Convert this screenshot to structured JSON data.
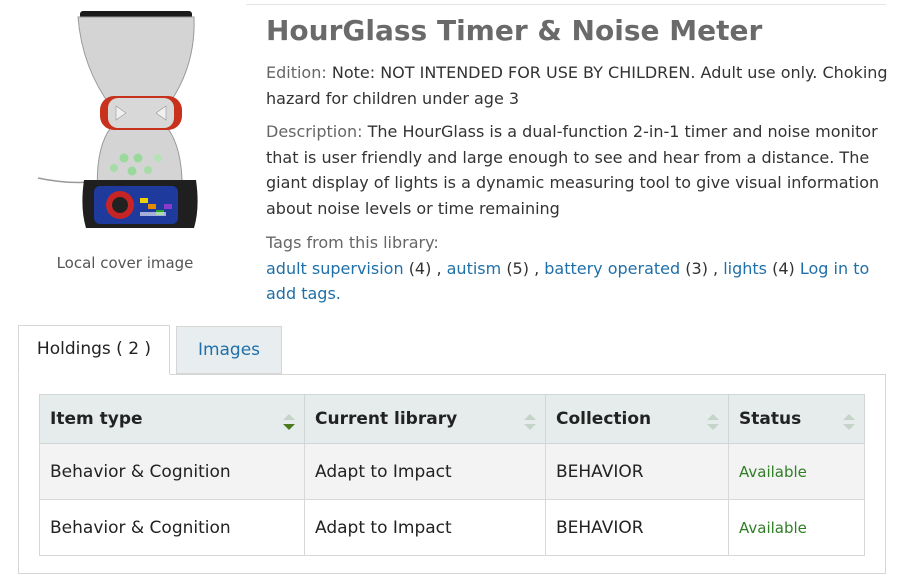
{
  "cover": {
    "caption": "Local cover image"
  },
  "title": "HourGlass Timer & Noise Meter",
  "edition": {
    "label": "Edition:",
    "value": "Note: NOT INTENDED FOR USE BY CHILDREN. Adult use only. Choking hazard for children under age 3"
  },
  "description": {
    "label": "Description:",
    "value": "The HourGlass is a dual-function 2-in-1 timer and noise monitor that is user friendly and large enough to see and hear from a distance. The giant display of lights is a dynamic measuring tool to give visual information about noise levels or time remaining"
  },
  "tags": {
    "label": "Tags from this library:",
    "items": [
      {
        "name": "adult supervision",
        "count": "(4)"
      },
      {
        "name": "autism",
        "count": "(5)"
      },
      {
        "name": "battery operated",
        "count": "(3)"
      },
      {
        "name": "lights",
        "count": "(4)"
      }
    ],
    "separator": " , ",
    "login_link": "Log in to add tags."
  },
  "tabs": {
    "holdings": "Holdings ( 2 )",
    "images": "Images"
  },
  "table": {
    "headers": [
      "Item type",
      "Current library",
      "Collection",
      "Status"
    ],
    "rows": [
      [
        "Behavior & Cognition",
        "Adapt to Impact",
        "BEHAVIOR",
        "Available"
      ],
      [
        "Behavior & Cognition",
        "Adapt to Impact",
        "BEHAVIOR",
        "Available"
      ]
    ]
  },
  "colors": {
    "link": "#1f6fa8",
    "available": "#2f7d24",
    "sort_active": "#4b7a1f",
    "sort_inactive": "#c4d4c8"
  }
}
